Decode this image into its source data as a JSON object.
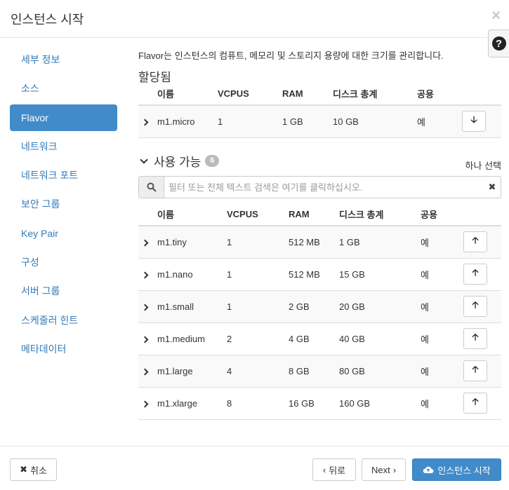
{
  "modal": {
    "title": "인스턴스 시작",
    "close_symbol": "×",
    "help_symbol": "?"
  },
  "sidebar": {
    "items": [
      {
        "label": "세부 정보",
        "active": false
      },
      {
        "label": "소스",
        "active": false
      },
      {
        "label": "Flavor",
        "active": true
      },
      {
        "label": "네트워크",
        "active": false
      },
      {
        "label": "네트워크 포트",
        "active": false
      },
      {
        "label": "보안 그룹",
        "active": false
      },
      {
        "label": "Key Pair",
        "active": false
      },
      {
        "label": "구성",
        "active": false
      },
      {
        "label": "서버 그룹",
        "active": false
      },
      {
        "label": "스케줄러 힌트",
        "active": false
      },
      {
        "label": "메타데이터",
        "active": false
      }
    ]
  },
  "main": {
    "description": "Flavor는 인스턴스의 컴퓨트, 메모리 및 스토리지 용량에 대한 크기를 관리합니다.",
    "allocated": {
      "title": "할당됨",
      "columns": [
        "이름",
        "VCPUS",
        "RAM",
        "디스크 총계",
        "공용"
      ],
      "rows": [
        {
          "name": "m1.micro",
          "vcpus": "1",
          "ram": "1 GB",
          "disk": "10 GB",
          "public": "예"
        }
      ]
    },
    "available": {
      "title": "사용 가능",
      "count": "6",
      "select_one": "하나 선택",
      "search_placeholder": "필터 또는 전체 텍스트 검색은 여기를 클릭하십시오.",
      "columns": [
        "이름",
        "VCPUS",
        "RAM",
        "디스크 총계",
        "공용"
      ],
      "rows": [
        {
          "name": "m1.tiny",
          "vcpus": "1",
          "ram": "512 MB",
          "disk": "1 GB",
          "public": "예"
        },
        {
          "name": "m1.nano",
          "vcpus": "1",
          "ram": "512 MB",
          "disk": "15 GB",
          "public": "예"
        },
        {
          "name": "m1.small",
          "vcpus": "1",
          "ram": "2 GB",
          "disk": "20 GB",
          "public": "예"
        },
        {
          "name": "m1.medium",
          "vcpus": "2",
          "ram": "4 GB",
          "disk": "40 GB",
          "public": "예"
        },
        {
          "name": "m1.large",
          "vcpus": "4",
          "ram": "8 GB",
          "disk": "80 GB",
          "public": "예"
        },
        {
          "name": "m1.xlarge",
          "vcpus": "8",
          "ram": "16 GB",
          "disk": "160 GB",
          "public": "예"
        }
      ]
    }
  },
  "footer": {
    "cancel_label": "취소",
    "back_label": "뒤로",
    "next_label": "Next",
    "launch_label": "인스턴스 시작"
  },
  "colors": {
    "primary": "#428bca",
    "link": "#337ab7",
    "border": "#dddddd"
  }
}
